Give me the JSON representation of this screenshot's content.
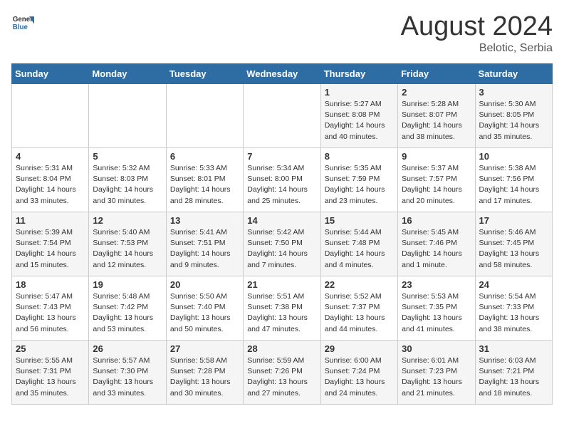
{
  "header": {
    "logo_general": "General",
    "logo_blue": "Blue",
    "month_year": "August 2024",
    "location": "Belotic, Serbia"
  },
  "days_of_week": [
    "Sunday",
    "Monday",
    "Tuesday",
    "Wednesday",
    "Thursday",
    "Friday",
    "Saturday"
  ],
  "weeks": [
    [
      {
        "day": "",
        "info": ""
      },
      {
        "day": "",
        "info": ""
      },
      {
        "day": "",
        "info": ""
      },
      {
        "day": "",
        "info": ""
      },
      {
        "day": "1",
        "info": "Sunrise: 5:27 AM\nSunset: 8:08 PM\nDaylight: 14 hours\nand 40 minutes."
      },
      {
        "day": "2",
        "info": "Sunrise: 5:28 AM\nSunset: 8:07 PM\nDaylight: 14 hours\nand 38 minutes."
      },
      {
        "day": "3",
        "info": "Sunrise: 5:30 AM\nSunset: 8:05 PM\nDaylight: 14 hours\nand 35 minutes."
      }
    ],
    [
      {
        "day": "4",
        "info": "Sunrise: 5:31 AM\nSunset: 8:04 PM\nDaylight: 14 hours\nand 33 minutes."
      },
      {
        "day": "5",
        "info": "Sunrise: 5:32 AM\nSunset: 8:03 PM\nDaylight: 14 hours\nand 30 minutes."
      },
      {
        "day": "6",
        "info": "Sunrise: 5:33 AM\nSunset: 8:01 PM\nDaylight: 14 hours\nand 28 minutes."
      },
      {
        "day": "7",
        "info": "Sunrise: 5:34 AM\nSunset: 8:00 PM\nDaylight: 14 hours\nand 25 minutes."
      },
      {
        "day": "8",
        "info": "Sunrise: 5:35 AM\nSunset: 7:59 PM\nDaylight: 14 hours\nand 23 minutes."
      },
      {
        "day": "9",
        "info": "Sunrise: 5:37 AM\nSunset: 7:57 PM\nDaylight: 14 hours\nand 20 minutes."
      },
      {
        "day": "10",
        "info": "Sunrise: 5:38 AM\nSunset: 7:56 PM\nDaylight: 14 hours\nand 17 minutes."
      }
    ],
    [
      {
        "day": "11",
        "info": "Sunrise: 5:39 AM\nSunset: 7:54 PM\nDaylight: 14 hours\nand 15 minutes."
      },
      {
        "day": "12",
        "info": "Sunrise: 5:40 AM\nSunset: 7:53 PM\nDaylight: 14 hours\nand 12 minutes."
      },
      {
        "day": "13",
        "info": "Sunrise: 5:41 AM\nSunset: 7:51 PM\nDaylight: 14 hours\nand 9 minutes."
      },
      {
        "day": "14",
        "info": "Sunrise: 5:42 AM\nSunset: 7:50 PM\nDaylight: 14 hours\nand 7 minutes."
      },
      {
        "day": "15",
        "info": "Sunrise: 5:44 AM\nSunset: 7:48 PM\nDaylight: 14 hours\nand 4 minutes."
      },
      {
        "day": "16",
        "info": "Sunrise: 5:45 AM\nSunset: 7:46 PM\nDaylight: 14 hours\nand 1 minute."
      },
      {
        "day": "17",
        "info": "Sunrise: 5:46 AM\nSunset: 7:45 PM\nDaylight: 13 hours\nand 58 minutes."
      }
    ],
    [
      {
        "day": "18",
        "info": "Sunrise: 5:47 AM\nSunset: 7:43 PM\nDaylight: 13 hours\nand 56 minutes."
      },
      {
        "day": "19",
        "info": "Sunrise: 5:48 AM\nSunset: 7:42 PM\nDaylight: 13 hours\nand 53 minutes."
      },
      {
        "day": "20",
        "info": "Sunrise: 5:50 AM\nSunset: 7:40 PM\nDaylight: 13 hours\nand 50 minutes."
      },
      {
        "day": "21",
        "info": "Sunrise: 5:51 AM\nSunset: 7:38 PM\nDaylight: 13 hours\nand 47 minutes."
      },
      {
        "day": "22",
        "info": "Sunrise: 5:52 AM\nSunset: 7:37 PM\nDaylight: 13 hours\nand 44 minutes."
      },
      {
        "day": "23",
        "info": "Sunrise: 5:53 AM\nSunset: 7:35 PM\nDaylight: 13 hours\nand 41 minutes."
      },
      {
        "day": "24",
        "info": "Sunrise: 5:54 AM\nSunset: 7:33 PM\nDaylight: 13 hours\nand 38 minutes."
      }
    ],
    [
      {
        "day": "25",
        "info": "Sunrise: 5:55 AM\nSunset: 7:31 PM\nDaylight: 13 hours\nand 35 minutes."
      },
      {
        "day": "26",
        "info": "Sunrise: 5:57 AM\nSunset: 7:30 PM\nDaylight: 13 hours\nand 33 minutes."
      },
      {
        "day": "27",
        "info": "Sunrise: 5:58 AM\nSunset: 7:28 PM\nDaylight: 13 hours\nand 30 minutes."
      },
      {
        "day": "28",
        "info": "Sunrise: 5:59 AM\nSunset: 7:26 PM\nDaylight: 13 hours\nand 27 minutes."
      },
      {
        "day": "29",
        "info": "Sunrise: 6:00 AM\nSunset: 7:24 PM\nDaylight: 13 hours\nand 24 minutes."
      },
      {
        "day": "30",
        "info": "Sunrise: 6:01 AM\nSunset: 7:23 PM\nDaylight: 13 hours\nand 21 minutes."
      },
      {
        "day": "31",
        "info": "Sunrise: 6:03 AM\nSunset: 7:21 PM\nDaylight: 13 hours\nand 18 minutes."
      }
    ]
  ]
}
